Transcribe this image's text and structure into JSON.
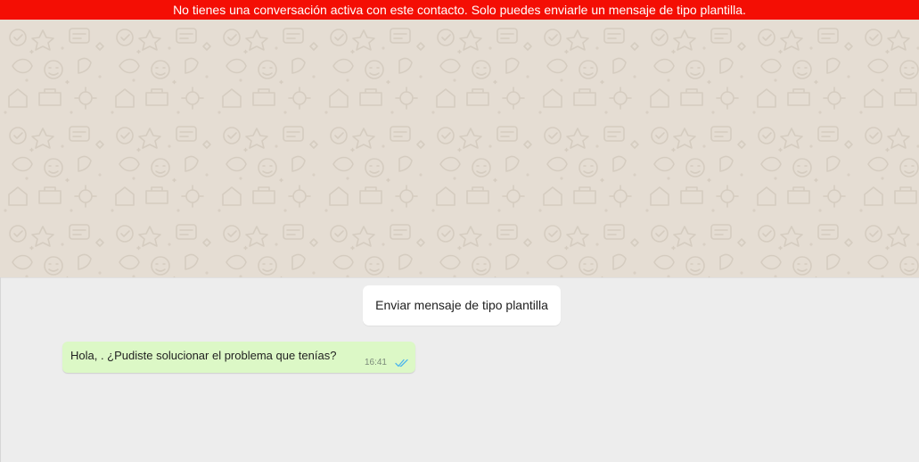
{
  "banner": {
    "text": "No tienes una conversación activa con este contacto. Solo puedes enviarle un mensaje de tipo plantilla.",
    "color": "#f40e04"
  },
  "wallpaper": {
    "color": "#e5ddd3",
    "pattern": "doodle-pattern"
  },
  "actions": {
    "template_button_label": "Enviar mensaje de tipo plantilla"
  },
  "messages": [
    {
      "text": "Hola, . ¿Pudiste solucionar el problema que tenías?",
      "time": "16:41",
      "status_icon": "double-check-icon",
      "bubble_color": "#dcf8c6",
      "check_color": "#4fb6ec"
    }
  ]
}
